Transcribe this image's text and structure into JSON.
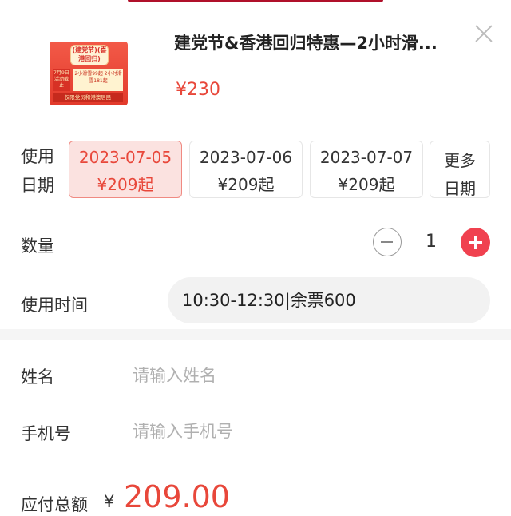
{
  "product": {
    "title": "建党节&香港回归特惠—2小时滑...",
    "price": "¥230",
    "image": {
      "pill": "(建党节)(喜港回归)",
      "left_text": "7月9日活动截止",
      "right_text": "2小滑雪99起 2小时滑雪181起",
      "bottom_text": "仅限党员和港澳居民"
    }
  },
  "date": {
    "label": "使用日期",
    "options": [
      {
        "date": "2023-07-05",
        "price": "¥209起",
        "selected": true
      },
      {
        "date": "2023-07-06",
        "price": "¥209起",
        "selected": false
      },
      {
        "date": "2023-07-07",
        "price": "¥209起",
        "selected": false
      }
    ],
    "more_line1": "更多",
    "more_line2": "日期"
  },
  "quantity": {
    "label": "数量",
    "value": "1"
  },
  "time": {
    "label": "使用时间",
    "value": "10:30-12:30|余票600"
  },
  "form": {
    "name_label": "姓名",
    "name_placeholder": "请输入姓名",
    "phone_label": "手机号",
    "phone_placeholder": "请输入手机号"
  },
  "total": {
    "label": "应付总额",
    "currency": "¥",
    "amount": "209.00"
  },
  "colors": {
    "accent": "#e8473a",
    "plus": "#f0414f",
    "selected_bg": "#fbe2e0"
  }
}
